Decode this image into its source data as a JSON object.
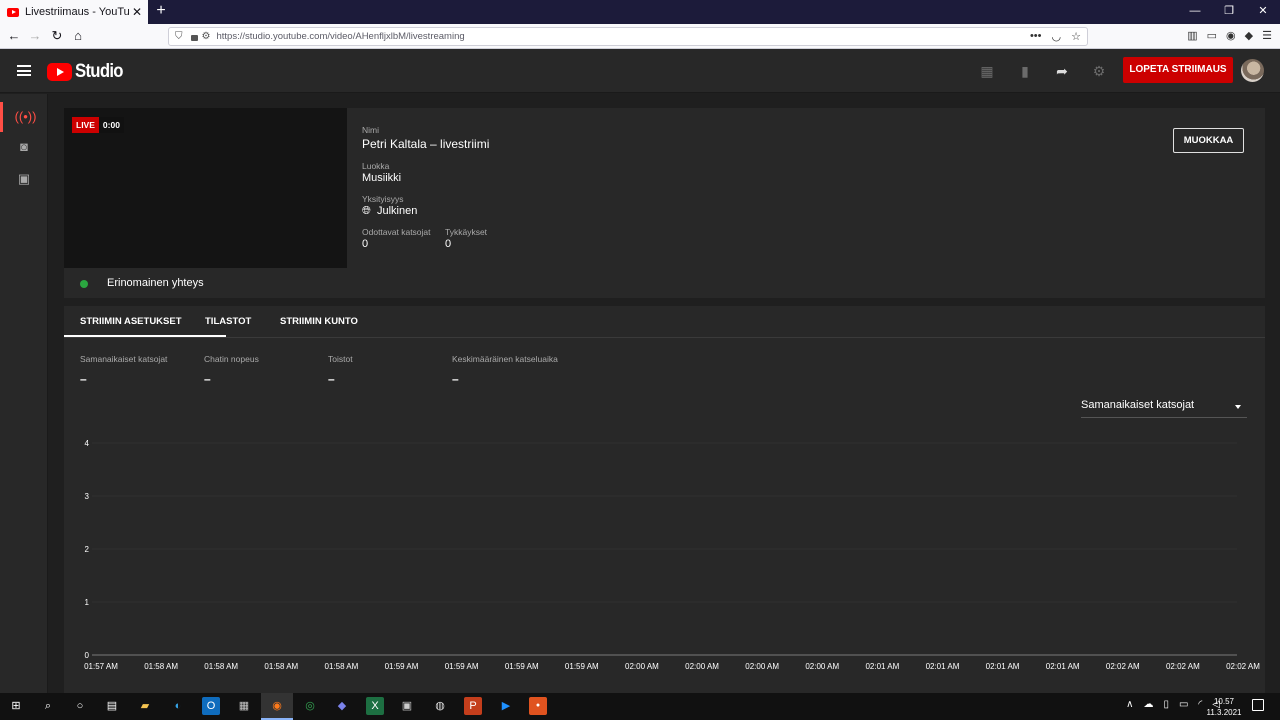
{
  "browser": {
    "tab_title": "Livestriimaus - YouTube Studio",
    "tab_close": "✕",
    "new_tab": "+",
    "url": "https://studio.youtube.com/video/AHenfljxlbM/livestreaming",
    "win_minimize": "—",
    "win_restore": "❐",
    "win_close": "✕"
  },
  "header": {
    "logo_text": "Studio",
    "end_stream_label": "LOPETA STRIIMAUS"
  },
  "stream": {
    "live_badge": "LIVE",
    "elapsed": "0:00",
    "name_label": "Nimi",
    "name_value": "Petri Kaltala – livestriimi",
    "category_label": "Luokka",
    "category_value": "Musiikki",
    "privacy_label": "Yksityisyys",
    "privacy_value": "Julkinen",
    "waiting_label": "Odottavat katsojat",
    "waiting_value": "0",
    "likes_label": "Tykkäykset",
    "likes_value": "0",
    "edit_label": "MUOKKAA",
    "connection_text": "Erinomainen yhteys"
  },
  "tabs": [
    "STRIIMIN ASETUKSET",
    "TILASTOT",
    "STRIIMIN KUNTO"
  ],
  "stats": [
    {
      "label": "Samanaikaiset katsojat",
      "value": "–"
    },
    {
      "label": "Chatin nopeus",
      "value": "–"
    },
    {
      "label": "Toistot",
      "value": "–"
    },
    {
      "label": "Keskimääräinen katseluaika",
      "value": "–"
    }
  ],
  "metric_select": "Samanaikaiset katsojat",
  "chart_data": {
    "type": "line",
    "title": "",
    "xlabel": "",
    "ylabel": "",
    "ylim": [
      0,
      4
    ],
    "yticks": [
      "0",
      "1",
      "2",
      "3",
      "4"
    ],
    "x": [
      "01:57 AM",
      "01:58 AM",
      "01:58 AM",
      "01:58 AM",
      "01:58 AM",
      "01:59 AM",
      "01:59 AM",
      "01:59 AM",
      "01:59 AM",
      "02:00 AM",
      "02:00 AM",
      "02:00 AM",
      "02:00 AM",
      "02:01 AM",
      "02:01 AM",
      "02:01 AM",
      "02:01 AM",
      "02:02 AM",
      "02:02 AM",
      "02:02 AM"
    ],
    "series": [],
    "grid": true
  },
  "taskbar": {
    "time": "10.57",
    "date": "11.3.2021"
  },
  "colors": {
    "accent_red": "#cc0000",
    "status_green": "#2ba640",
    "panel_bg": "#282828",
    "page_bg": "#1f1f1f"
  }
}
